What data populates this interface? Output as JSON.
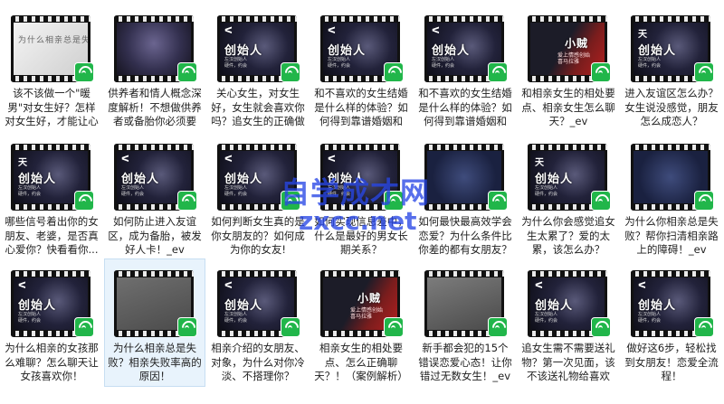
{
  "items": [
    {
      "row": 0,
      "col": 0,
      "theme": "t-light",
      "mark": "",
      "frame_title": "为什么相亲总是失败",
      "frame_sub": "",
      "label": "该不该做一个\"暖男\"对女生好？怎样对女生好，才能让心仪的女..."
    },
    {
      "row": 0,
      "col": 1,
      "theme": "t-purple",
      "mark": "",
      "frame_title": "",
      "frame_sub": "",
      "label": "供养者和情人概念深度解析！不想做供养者或备胎你必须要了..."
    },
    {
      "row": 0,
      "col": 2,
      "theme": "t-dark",
      "mark": "ᐸ",
      "frame_title": "创始人",
      "frame_sub": "左汉创始人\n硬件，约会",
      "label": "关心女生，对女生好，女生就会喜欢你吗？追女生的正确做法..."
    },
    {
      "row": 0,
      "col": 3,
      "theme": "t-dark",
      "mark": "ᐸ",
      "frame_title": "创始人",
      "frame_sub": "左汉创始人\n硬件，约会",
      "label": "和不喜欢的女生结婚是什么样的体验？如何得到靠谱婚姻和结..."
    },
    {
      "row": 0,
      "col": 4,
      "theme": "t-dark",
      "mark": "ᐸ",
      "frame_title": "创始人",
      "frame_sub": "左汉创始人\n硬件，约会",
      "label": "和不喜欢的女生结婚是什么样的体验？如何得到靠谱婚姻和结..."
    },
    {
      "row": 0,
      "col": 5,
      "theme": "t-red",
      "mark": "",
      "frame_title": "小贼",
      "frame_sub": "爱上情感创始\n喜马拉雅",
      "label": "和相亲女生的相处要点、相亲女生怎么聊天？_ev"
    },
    {
      "row": 0,
      "col": 6,
      "theme": "t-dark",
      "mark": "天",
      "frame_title": "创始人",
      "frame_sub": "左汉创始人\n硬件，约会",
      "label": "进入友谊区怎么办？女生说没感觉，朋友怎么成恋人？"
    },
    {
      "row": 1,
      "col": 0,
      "theme": "t-dark",
      "mark": "天",
      "frame_title": "创始人",
      "frame_sub": "左汉创始人\n硬件，约会",
      "label": "哪些信号着出你的女朋友、老婆，是否真心爱你？快看看你..."
    },
    {
      "row": 1,
      "col": 1,
      "theme": "t-dark",
      "mark": "ᐸ",
      "frame_title": "创始人",
      "frame_sub": "左汉创始人\n硬件，约会",
      "label": "如何防止进入友谊区，成为备胎，被发好人卡！_ev"
    },
    {
      "row": 1,
      "col": 2,
      "theme": "t-dark",
      "mark": "ᐸ",
      "frame_title": "创始人",
      "frame_sub": "左汉创始人\n硬件，约会",
      "label": "如何判断女生真的是你女朋友的？如何成为你的女友!"
    },
    {
      "row": 1,
      "col": 3,
      "theme": "t-dark",
      "mark": "ᐸ",
      "frame_title": "创始人",
      "frame_sub": "左汉创始人\n硬件，约会",
      "label": "如何实现信息差中，什么是最好的男女长期关系？"
    },
    {
      "row": 1,
      "col": 4,
      "theme": "t-blue",
      "mark": "",
      "frame_title": "",
      "frame_sub": "",
      "label": "如何最快最高效学会恋爱？为什么条件比你差的都有女朋友？"
    },
    {
      "row": 1,
      "col": 5,
      "theme": "t-dark",
      "mark": "天",
      "frame_title": "创始人",
      "frame_sub": "左汉创始人\n硬件，约会",
      "label": "为什么你会感觉追女生太累了？爱的太累，该怎么办？"
    },
    {
      "row": 1,
      "col": 6,
      "theme": "t-blue",
      "mark": "",
      "frame_title": "",
      "frame_sub": "",
      "label": "为什么你相亲总是失败？帮你扫清相亲路上的障碍！_ev"
    },
    {
      "row": 2,
      "col": 0,
      "theme": "t-dark",
      "mark": "ᐸ",
      "frame_title": "创始人",
      "frame_sub": "左汉创始人\n硬件，约会",
      "label": "为什么相亲的女孩那么难聊？怎么聊天让女孩喜欢你！"
    },
    {
      "row": 2,
      "col": 1,
      "theme": "t-blank",
      "mark": "",
      "frame_title": "",
      "frame_sub": "",
      "label": "为什么相亲总是失败？相亲失败率高的原因！",
      "selected": true
    },
    {
      "row": 2,
      "col": 2,
      "theme": "t-dark",
      "mark": "ᐸ",
      "frame_title": "创始人",
      "frame_sub": "左汉创始人\n硬件，约会",
      "label": "相亲介绍的女朋友、对象，为什么对你冷淡、不搭理你？"
    },
    {
      "row": 2,
      "col": 3,
      "theme": "t-red",
      "mark": "",
      "frame_title": "小贼",
      "frame_sub": "爱上情感创始\n喜马拉雅",
      "label": "相亲女生的相处要点、怎么正确聊天？！（案例解析）"
    },
    {
      "row": 2,
      "col": 4,
      "theme": "t-gray2",
      "mark": "",
      "frame_title": "",
      "frame_sub": "",
      "label": "新手都会犯的15个错误恋爱心态！让你错过无数女生！_ev"
    },
    {
      "row": 2,
      "col": 5,
      "theme": "t-dark",
      "mark": "ᐸ",
      "frame_title": "创始人",
      "frame_sub": "左汉创始人\n硬件，约会",
      "label": "追女生需不需要送礼物？第一次见面，该不该送礼物给喜欢的..."
    },
    {
      "row": 2,
      "col": 6,
      "theme": "t-dark",
      "mark": "ᐸ",
      "frame_title": "创始人",
      "frame_sub": "左汉创始人\n硬件，约会",
      "label": "做好这6步，轻松找到女朋友！恋爱全流程！"
    }
  ],
  "watermark": {
    "line1": "自学成才网",
    "line2": "zxcc.net"
  },
  "icons": {
    "badge": "green-wifi-badge-icon"
  },
  "colors": {
    "badge": "#21b64a",
    "watermark": "#2846e6",
    "selected_bg": "#e8f3fc"
  }
}
